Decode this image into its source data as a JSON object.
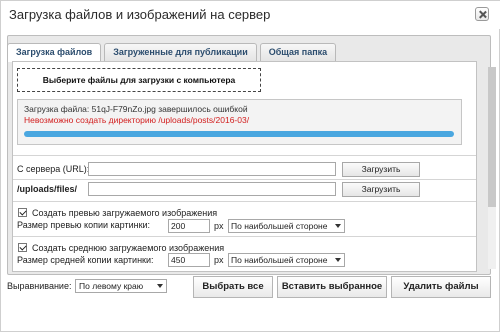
{
  "window": {
    "title": "Загрузка файлов и изображений на сервер",
    "close_icon": "close-icon"
  },
  "tabs": [
    {
      "label": "Загрузка файлов",
      "active": true
    },
    {
      "label": "Загруженные для публикации",
      "active": false
    },
    {
      "label": "Общая папка",
      "active": false
    }
  ],
  "upload": {
    "pick_button": "Выберите файлы для загрузки с компьютера",
    "status_text": "Загрузка файла: 51qJ-F79nZo.jpg  завершилось ошибкой",
    "error_text": "Невозможно создать директорию /uploads/posts/2016-03/",
    "progress_percent": 100,
    "progress_color": "#4aa7e0",
    "error_color": "#d21e1e"
  },
  "server": {
    "label": "С сервера (URL):",
    "url_value": "",
    "button": "Загрузить"
  },
  "path": {
    "label": "/uploads/files/",
    "value": "",
    "button": "Загрузить"
  },
  "preview": {
    "checkbox_label": "Создать превью загружаемого изображения",
    "checked": true,
    "size_label": "Размер превью копии картинки:",
    "size_value": "200",
    "unit": "px",
    "side_option": "По наибольшей стороне"
  },
  "medium": {
    "checkbox_label": "Создать среднюю загружаемого изображения",
    "checked": true,
    "size_label": "Размер средней копии картинки:",
    "size_value": "450",
    "unit": "px",
    "side_option": "По наибольшей стороне"
  },
  "footer": {
    "align_label": "Выравнивание:",
    "align_option": "По левому краю",
    "select_all": "Выбрать все",
    "insert_selected": "Вставить выбранное",
    "delete_files": "Удалить файлы"
  }
}
